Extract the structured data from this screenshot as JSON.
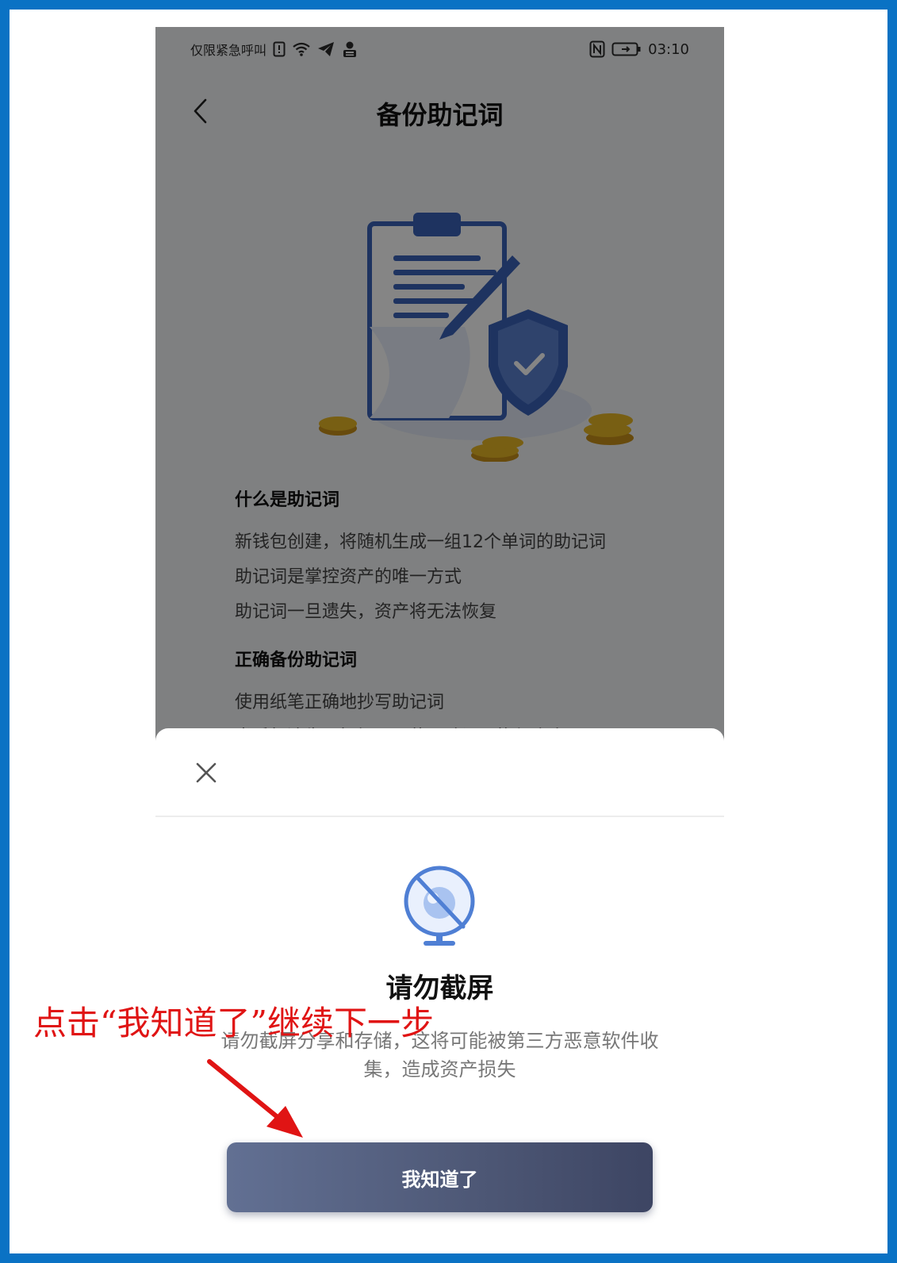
{
  "status_bar": {
    "carrier": "仅限紧急呼叫",
    "time": "03:10"
  },
  "nav": {
    "title": "备份助记词",
    "back_icon": "chevron-left-icon"
  },
  "sections": [
    {
      "title": "什么是助记词",
      "lines": [
        "新钱包创建，将随机生成一组12个单词的助记词",
        "助记词是掌控资产的唯一方式",
        "助记词一旦遗失，资产将无法恢复"
      ]
    },
    {
      "title": "正确备份助记词",
      "lines": [
        "使用纸笔正确地抄写助记词",
        "当手机遗失、损坏，可使用助记词恢复资产"
      ]
    }
  ],
  "modal": {
    "close_icon": "close-icon",
    "icon": "no-screenshot-camera-icon",
    "title": "请勿截屏",
    "description": "请勿截屏分享和存储，这将可能被第三方恶意软件收集，造成资产损失",
    "button_label": "我知道了"
  },
  "annotation": {
    "text": "点击“我知道了”继续下一步",
    "color": "#e01414"
  },
  "colors": {
    "frame_border": "#0a72c4",
    "button_start": "#627093",
    "button_end": "#3d4563",
    "illustration_blue": "#3b63b8",
    "coin_gold": "#e7b626"
  }
}
